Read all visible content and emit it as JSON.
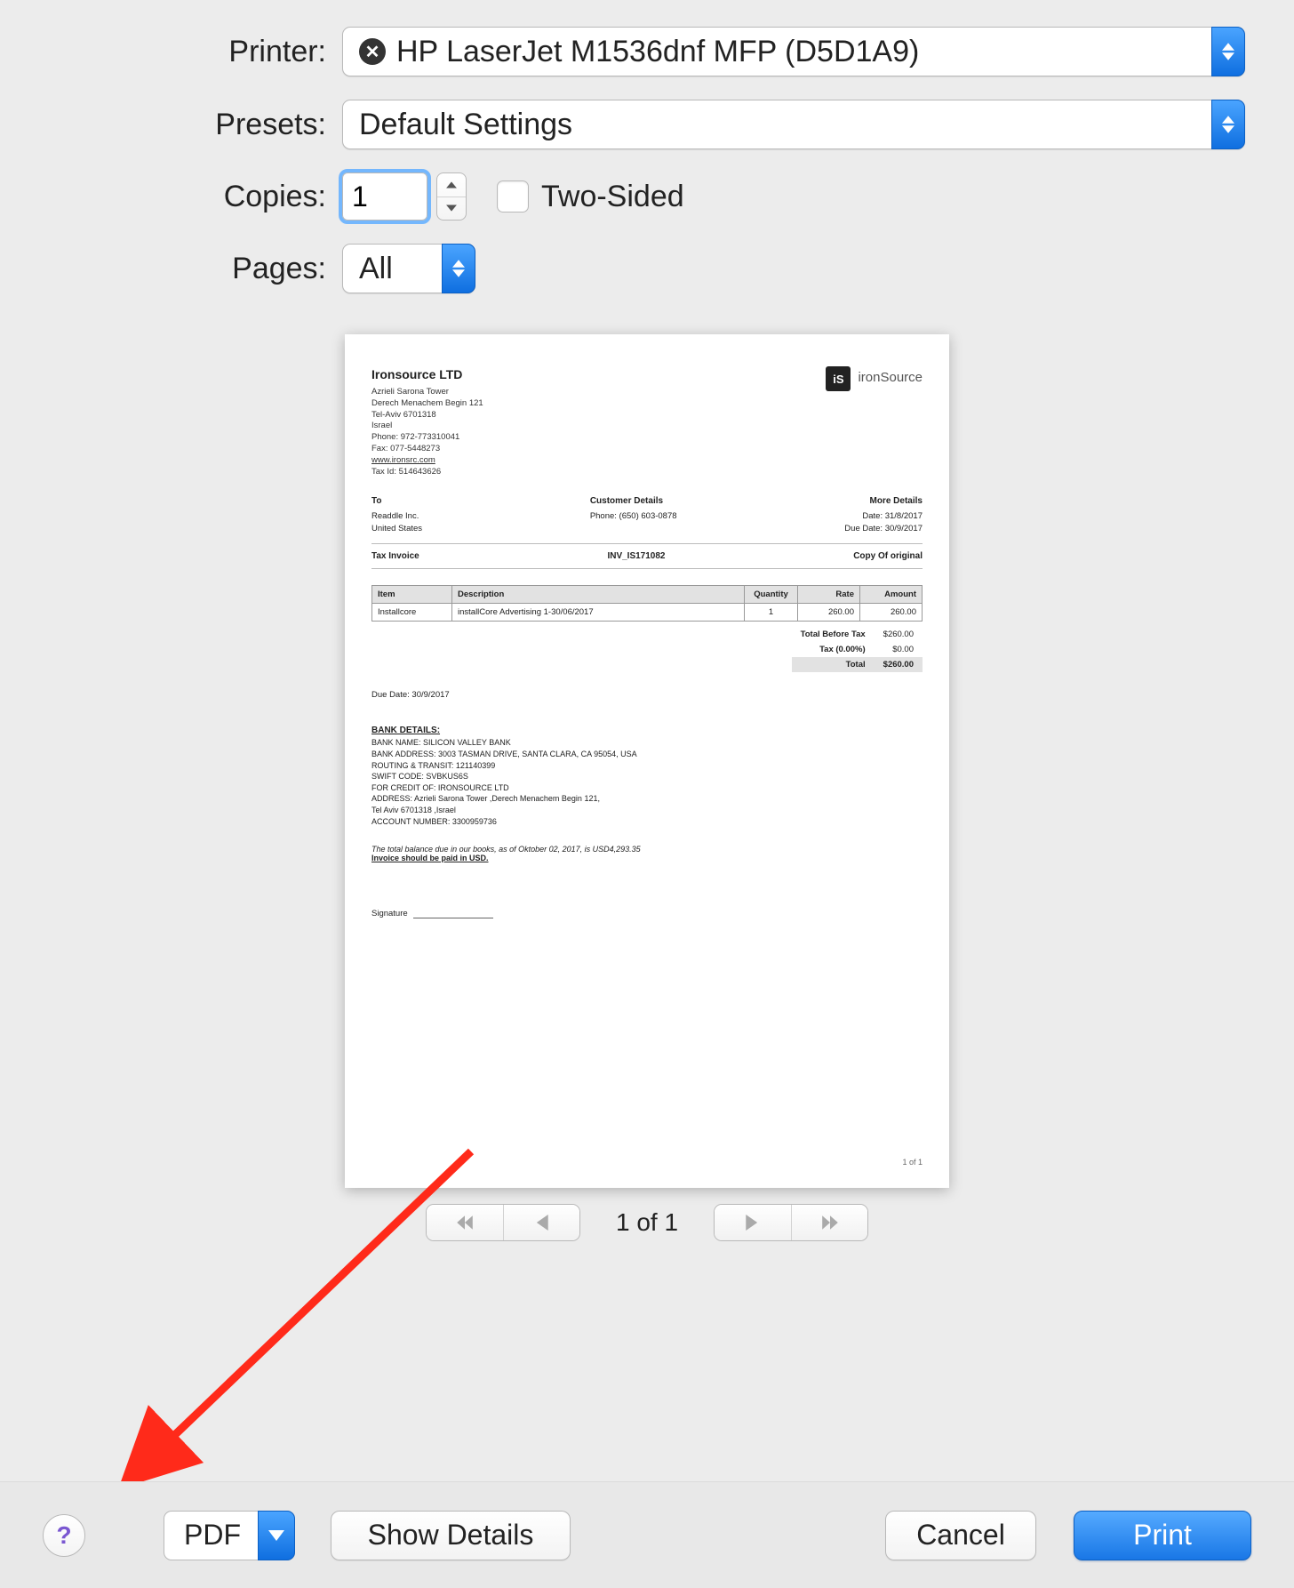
{
  "labels": {
    "printer": "Printer:",
    "presets": "Presets:",
    "copies": "Copies:",
    "pages": "Pages:"
  },
  "printer": {
    "name": "HP LaserJet M1536dnf MFP (D5D1A9)",
    "status_glyph": "✕"
  },
  "presets": {
    "selected": "Default Settings"
  },
  "copies": {
    "value": "1",
    "two_sided_label": "Two-Sided"
  },
  "pages": {
    "selected": "All"
  },
  "pager": {
    "text": "1 of 1"
  },
  "bottom": {
    "help": "?",
    "pdf": "PDF",
    "details": "Show Details",
    "cancel": "Cancel",
    "print": "Print"
  },
  "invoice": {
    "company": "Ironsource LTD",
    "addr": [
      "Azrieli Sarona Tower",
      "Derech Menachem Begin 121",
      "Tel-Aviv 6701318",
      "Israel",
      "Phone: 972-773310041",
      "Fax: 077-5448273"
    ],
    "web": "www.ironsrc.com",
    "tax_id": "Tax Id: 514643626",
    "brand": "ironSource",
    "to_hdr": "To",
    "to": [
      "Readdle Inc.",
      "United States"
    ],
    "cust_hdr": "Customer Details",
    "cust": [
      "Phone: (650) 603-0878"
    ],
    "more_hdr": "More Details",
    "more": [
      "Date: 31/8/2017",
      "Due Date: 30/9/2017"
    ],
    "inv_label": "Tax Invoice",
    "inv_no": "INV_IS171082",
    "inv_copy": "Copy Of original",
    "th": [
      "Item",
      "Description",
      "Quantity",
      "Rate",
      "Amount"
    ],
    "row": [
      "Installcore",
      "installCore Advertising 1-30/06/2017",
      "1",
      "260.00",
      "260.00"
    ],
    "totals": [
      [
        "Total Before Tax",
        "$260.00"
      ],
      [
        "Tax (0.00%)",
        "$0.00"
      ],
      [
        "Total",
        "$260.00"
      ]
    ],
    "due": "Due Date: 30/9/2017",
    "bank_hdr": "BANK DETAILS:",
    "bank": [
      "BANK NAME: SILICON VALLEY BANK",
      "BANK ADDRESS: 3003 TASMAN DRIVE, SANTA CLARA, CA 95054, USA",
      "ROUTING & TRANSIT: 121140399",
      "SWIFT CODE: SVBKUS6S",
      "FOR CREDIT OF: IRONSOURCE LTD",
      "ADDRESS: Azrieli Sarona Tower ,Derech Menachem Begin 121,",
      "Tel Aviv 6701318 ,Israel",
      "ACCOUNT NUMBER: 3300959736"
    ],
    "balance": "The total balance due in our books, as of Oktober 02, 2017, is USD4,293.35",
    "balance_u": "Invoice should be paid in USD.",
    "signature": "Signature",
    "page": "1 of 1"
  }
}
